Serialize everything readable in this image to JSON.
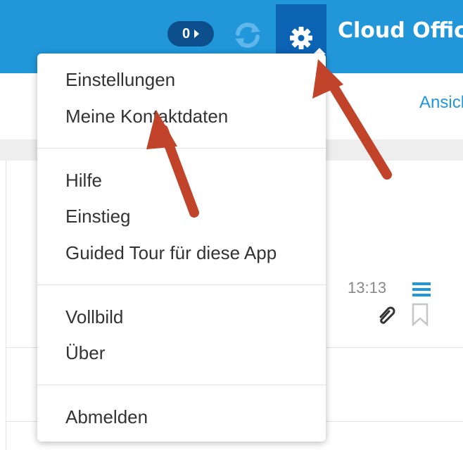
{
  "header": {
    "counter": "0",
    "app_title": "Cloud Office",
    "accent_color": "#2196d9",
    "active_color": "#0c62b3"
  },
  "content": {
    "view_label": "Ansicht",
    "mail_time": "13:13"
  },
  "menu": {
    "groups": [
      [
        "Einstellungen",
        "Meine Kontaktdaten"
      ],
      [
        "Hilfe",
        "Einstieg",
        "Guided Tour für diese App"
      ],
      [
        "Vollbild",
        "Über"
      ],
      [
        "Abmelden"
      ]
    ]
  },
  "annotations": {
    "arrow_color": "#c0432a",
    "count": 2
  }
}
